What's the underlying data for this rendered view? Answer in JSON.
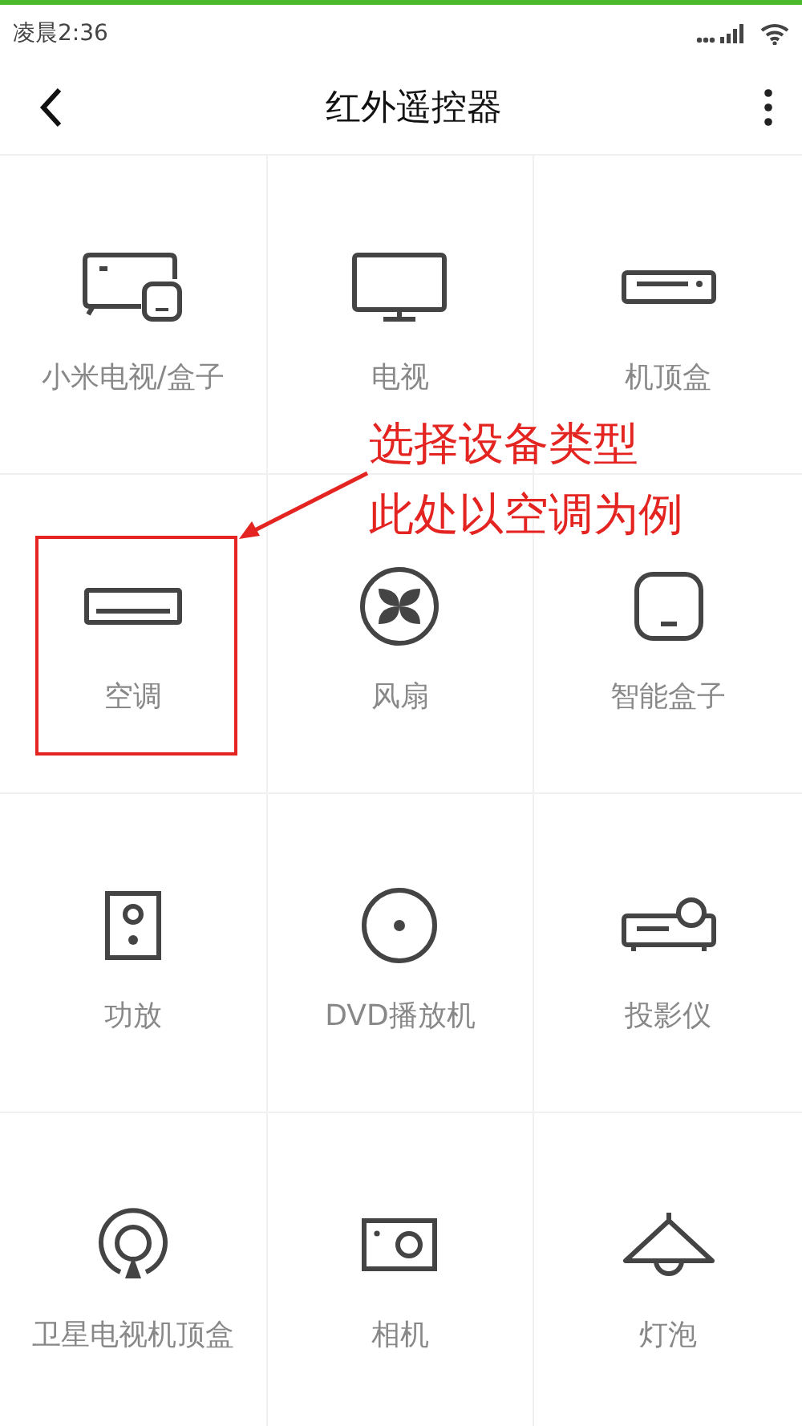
{
  "status_bar": {
    "time": "凌晨2:36"
  },
  "header": {
    "title": "红外遥控器"
  },
  "devices": [
    {
      "kind": "tv_box",
      "label": "小米电视/盒子",
      "highlighted": false
    },
    {
      "kind": "tv",
      "label": "电视",
      "highlighted": false
    },
    {
      "kind": "set_top_box",
      "label": "机顶盒",
      "highlighted": false
    },
    {
      "kind": "air_conditioner",
      "label": "空调",
      "highlighted": true
    },
    {
      "kind": "fan",
      "label": "风扇",
      "highlighted": false
    },
    {
      "kind": "smart_box",
      "label": "智能盒子",
      "highlighted": false
    },
    {
      "kind": "amplifier",
      "label": "功放",
      "highlighted": false
    },
    {
      "kind": "dvd",
      "label": "DVD播放机",
      "highlighted": false
    },
    {
      "kind": "projector",
      "label": "投影仪",
      "highlighted": false
    },
    {
      "kind": "satellite",
      "label": "卫星电视机顶盒",
      "highlighted": false
    },
    {
      "kind": "camera",
      "label": "相机",
      "highlighted": false
    },
    {
      "kind": "lamp",
      "label": "灯泡",
      "highlighted": false
    }
  ],
  "annotation": {
    "lines": [
      "选择设备类型",
      "此处以空调为例"
    ]
  }
}
